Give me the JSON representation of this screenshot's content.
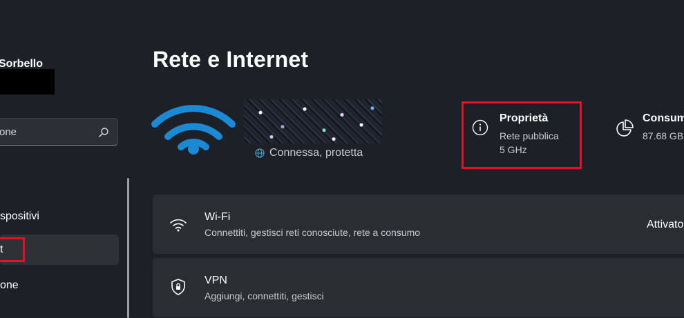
{
  "sidebar": {
    "user_name": "Sorbello",
    "search_text": "one",
    "items": [
      {
        "label": "spositivi"
      },
      {
        "label": "t"
      },
      {
        "label": "one"
      }
    ]
  },
  "header": {
    "title": "Rete e Internet"
  },
  "network": {
    "status": "Connessa, protetta",
    "properties_title": "Proprietà",
    "network_type": "Rete pubblica",
    "band": "5 GHz",
    "usage_title": "Consum",
    "usage_value": "87.68 GB"
  },
  "cards": [
    {
      "title": "Wi-Fi",
      "subtitle": "Connettiti, gestisci reti conosciute, rete a consumo",
      "status": "Attivato",
      "icon": "wifi-icon"
    },
    {
      "title": "VPN",
      "subtitle": "Aggiungi, connettiti, gestisci",
      "icon": "vpn-shield-icon"
    }
  ],
  "colors": {
    "accent": "#1a8ad4",
    "highlight": "#e81123",
    "background": "#1c2127"
  }
}
